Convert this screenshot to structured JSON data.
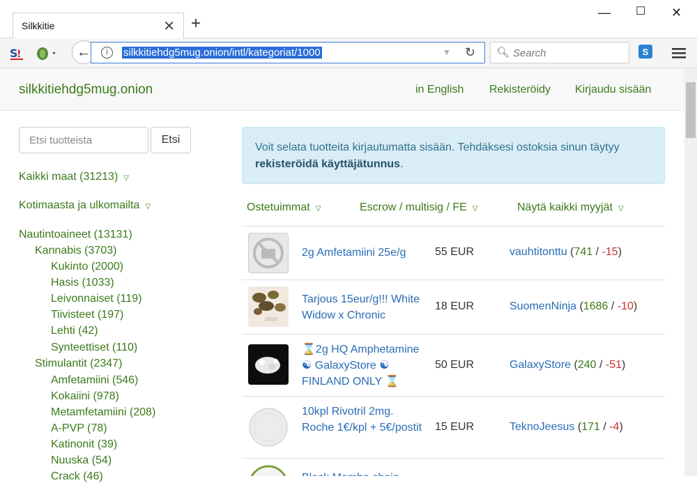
{
  "browser": {
    "tab_title": "Silkkitie",
    "url": "silkkitiehdg5mug.onion/intl/kategoriat/1000",
    "search_placeholder": "Search"
  },
  "site": {
    "brand": "silkkitiehdg5mug.onion",
    "nav": [
      "in English",
      "Rekisteröidy",
      "Kirjaudu sisään"
    ]
  },
  "sidebar": {
    "search_placeholder": "Etsi tuotteista",
    "search_button": "Etsi",
    "filters": [
      "Kaikki maat (31213)",
      "Kotimaasta ja ulkomailta"
    ],
    "categories": [
      {
        "label": "Nautintoaineet (13131)",
        "level": 0
      },
      {
        "label": "Kannabis (3703)",
        "level": 1
      },
      {
        "label": "Kukinto (2000)",
        "level": 2
      },
      {
        "label": "Hasis (1033)",
        "level": 2
      },
      {
        "label": "Leivonnaiset (119)",
        "level": 2
      },
      {
        "label": "Tiivisteet (197)",
        "level": 2
      },
      {
        "label": "Lehti (42)",
        "level": 2
      },
      {
        "label": "Synteettiset (110)",
        "level": 2
      },
      {
        "label": "Stimulantit (2347)",
        "level": 1
      },
      {
        "label": "Amfetamiini (546)",
        "level": 2
      },
      {
        "label": "Kokaiini (978)",
        "level": 2
      },
      {
        "label": "Metamfetamiini (208)",
        "level": 2
      },
      {
        "label": "A-PVP (78)",
        "level": 2
      },
      {
        "label": "Katinonit (39)",
        "level": 2
      },
      {
        "label": "Nuuska (54)",
        "level": 2
      },
      {
        "label": "Crack (46)",
        "level": 2
      }
    ]
  },
  "alert": {
    "line1": "Voit selata tuotteita kirjautumatta sisään. Tehdäksesi ostoksia sinun täytyy",
    "line2_bold": "rekisteröidä käyttäjätunnus",
    "line2_end": "."
  },
  "filters_bar": [
    "Ostetuimmat",
    "Escrow / multisig / FE",
    "Näytä kaikki myyjät"
  ],
  "products": [
    {
      "title": "2g Amfetamiini 25e/g",
      "price": "55 EUR",
      "seller": "vauhtitonttu",
      "pos": "741",
      "neg": "-15"
    },
    {
      "title": "Tarjous 15eur/g!!! White Widow x Chronic",
      "price": "18 EUR",
      "seller": "SuomenNinja",
      "pos": "1686",
      "neg": "-10"
    },
    {
      "title": "⌛2g HQ Amphetamine ☯ GalaxyStore ☯ FINLAND ONLY ⌛",
      "price": "50 EUR",
      "seller": "GalaxyStore",
      "pos": "240",
      "neg": "-51"
    },
    {
      "title": "10kpl Rivotril 2mg. Roche 1€/kpl + 5€/postit",
      "price": "15 EUR",
      "seller": "TeknoJeesus",
      "pos": "171",
      "neg": "-4"
    },
    {
      "title": "Black Mamba chain",
      "price": "",
      "seller": "",
      "pos": "",
      "neg": ""
    }
  ],
  "colors": {
    "link_green": "#3a7a1b",
    "link_blue": "#2a6cb5",
    "alert_bg": "#d9edf7"
  }
}
